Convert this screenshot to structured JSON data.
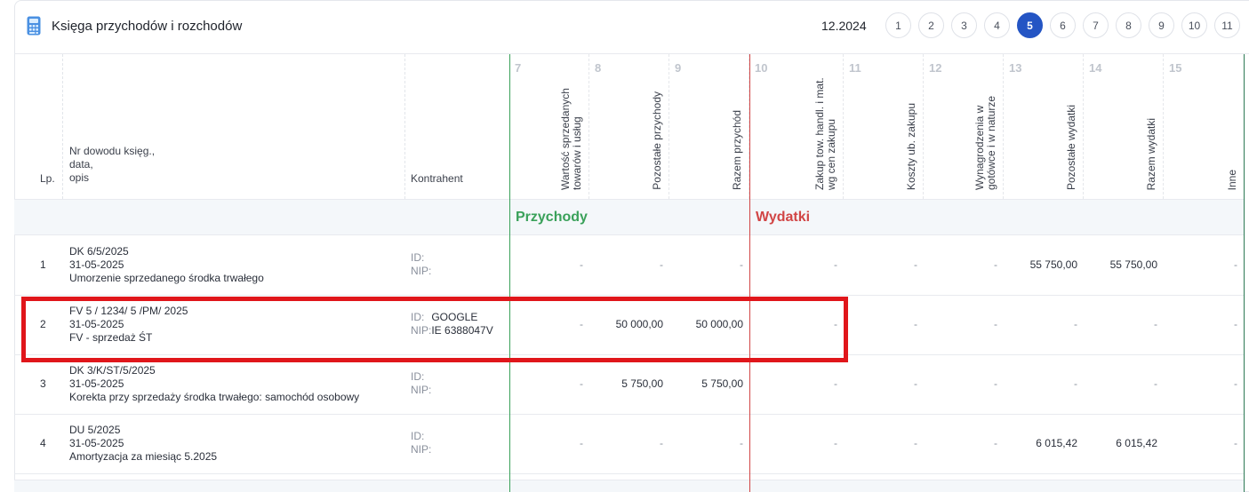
{
  "header": {
    "title": "Księga przychodów i rozchodów",
    "period": "12.2024",
    "pages": [
      "1",
      "2",
      "3",
      "4",
      "5",
      "6",
      "7",
      "8",
      "9",
      "10",
      "11"
    ],
    "active_page": "5"
  },
  "columns": {
    "lp": "Lp.",
    "nr_lines": [
      "Nr dowodu księg.,",
      "data,",
      "opis"
    ],
    "kontrahent": "Kontrahent",
    "numeric": [
      {
        "num": "7",
        "label": "Wartość sprzedanych towarów i usług"
      },
      {
        "num": "8",
        "label": "Pozostałe przychody"
      },
      {
        "num": "9",
        "label": "Razem przychód"
      },
      {
        "num": "10",
        "label": "Zakup tow. handl. i mat. wg cen zakupu"
      },
      {
        "num": "11",
        "label": "Koszty ub. zakupu"
      },
      {
        "num": "12",
        "label": "Wynagrodzenia w gotówce i w naturze"
      },
      {
        "num": "13",
        "label": "Pozostałe wydatki"
      },
      {
        "num": "14",
        "label": "Razem wydatki"
      },
      {
        "num": "15",
        "label": "Inne"
      }
    ]
  },
  "sections": {
    "przychody": "Przychody",
    "wydatki": "Wydatki"
  },
  "kontrahent_labels": {
    "id": "ID:",
    "nip": "NIP:"
  },
  "rows": [
    {
      "lp": "1",
      "doc": "DK 6/5/2025",
      "date": "31-05-2025",
      "desc": "Umorzenie sprzedanego środka trwałego",
      "id": "",
      "nip": "",
      "values": [
        "-",
        "-",
        "-",
        "-",
        "-",
        "-",
        "55 750,00",
        "55 750,00",
        "-"
      ]
    },
    {
      "lp": "2",
      "doc": "FV 5 / 1234/ 5 /PM/ 2025",
      "date": "31-05-2025",
      "desc": "FV - sprzedaż ŚT",
      "id": "GOOGLE",
      "nip": "IE 6388047V",
      "values": [
        "-",
        "50 000,00",
        "50 000,00",
        "-",
        "-",
        "-",
        "-",
        "-",
        "-"
      ]
    },
    {
      "lp": "3",
      "doc": "DK 3/K/ST/5/2025",
      "date": "31-05-2025",
      "desc": "Korekta przy sprzedaży środka trwałego: samochód osobowy",
      "id": "",
      "nip": "",
      "values": [
        "-",
        "5 750,00",
        "5 750,00",
        "-",
        "-",
        "-",
        "-",
        "-",
        "-"
      ]
    },
    {
      "lp": "4",
      "doc": "DU 5/2025",
      "date": "31-05-2025",
      "desc": "Amortyzacja za miesiąc 5.2025",
      "id": "",
      "nip": "",
      "values": [
        "-",
        "-",
        "-",
        "-",
        "-",
        "-",
        "6 015,42",
        "6 015,42",
        "-"
      ]
    }
  ]
}
